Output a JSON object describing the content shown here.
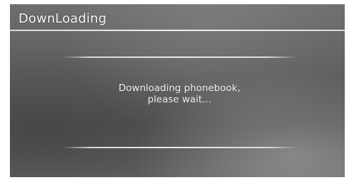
{
  "header": {
    "title": "DownLoading"
  },
  "dialog": {
    "message_line1": "Downloading phonebook,",
    "message_line2": "please wait..."
  },
  "colors": {
    "background": "#5e5e5e",
    "text": "#f2f2f2",
    "rule": "#e6e6e6"
  }
}
